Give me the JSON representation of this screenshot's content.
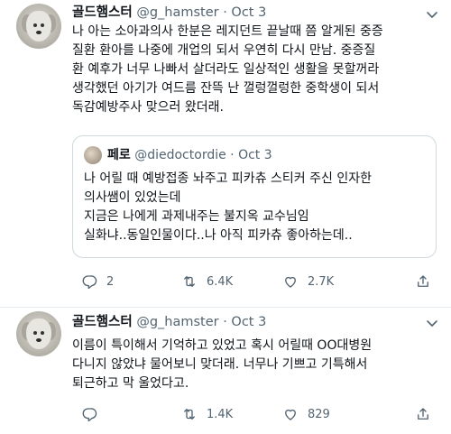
{
  "tweets": [
    {
      "author": {
        "name": "골드햄스터",
        "handle": "@g_hamster"
      },
      "separator": "·",
      "date": "Oct 3",
      "text_lines": [
        "나 아는 소아과의사 한분은 레지던트 끝날때 쯤 알게된 중증",
        "질환 환아를 나중에 개업의 되서 우연히 다시 만남. 중증질",
        "환 예후가 너무 나빠서 살더라도 일상적인 생활을 못할꺼라",
        "생각했던 아기가 여드름 잔뜩 난 껄렁껄렁한 중학생이 되서",
        "독감예방주사 맞으러 왔더래."
      ],
      "quote": {
        "author": {
          "name": "페로",
          "handle": "@diedoctordie"
        },
        "separator": "·",
        "date": "Oct 3",
        "text_lines": [
          "나 어릴 때 예방접종 놔주고 피카츄 스티커 주신 인자한",
          "의사쌤이 있었는데",
          "지금은 나에게 과제내주는 불지옥 교수님임",
          "실화냐..동일인물이다..나 아직 피카츄 좋아하는데.."
        ]
      },
      "actions": {
        "replies": "2",
        "retweets": "6.4K",
        "likes": "2.7K"
      }
    },
    {
      "author": {
        "name": "골드햄스터",
        "handle": "@g_hamster"
      },
      "separator": "·",
      "date": "Oct 3",
      "text_lines": [
        "이름이 특이해서 기억하고 있었고 혹시 어릴때 OO대병원",
        "다니지 않았냐 물어보니 맞더래. 너무나 기쁘고 기특해서",
        "퇴근하고 막 울었다고."
      ],
      "actions": {
        "replies": "",
        "retweets": "1.4K",
        "likes": "829"
      }
    }
  ],
  "icons": {
    "reply": "reply-icon",
    "retweet": "retweet-icon",
    "like": "heart-icon",
    "share": "share-icon",
    "more": "chevron-down-icon"
  },
  "colors": {
    "text": "#0f1419",
    "secondary": "#536471",
    "border": "#cfd9de"
  }
}
